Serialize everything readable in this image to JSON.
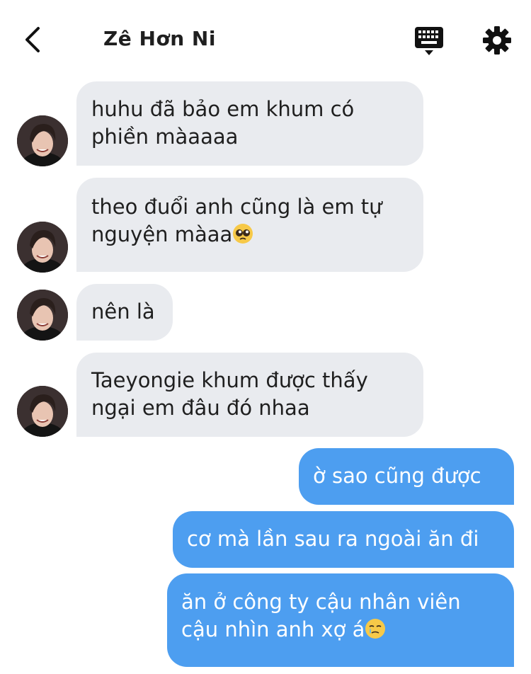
{
  "header": {
    "title": "Zê Hơn Ni",
    "icons": {
      "back": "chevron-left-icon",
      "keyboard": "keyboard-icon",
      "settings": "gear-icon"
    }
  },
  "messages": [
    {
      "from": "them",
      "lines": [
        "huhu đã bảo em khum có",
        "phiền màaaaa"
      ]
    },
    {
      "from": "them",
      "lines": [
        "theo đuổi anh cũng là em tự",
        "nguyện màaa"
      ],
      "emoji": "pleading-face"
    },
    {
      "from": "them",
      "lines": [
        "nên là"
      ]
    },
    {
      "from": "them",
      "lines": [
        "Taeyongie khum được thấy",
        "ngại em đâu đó nhaa"
      ]
    },
    {
      "from": "me",
      "lines": [
        "ờ sao cũng được"
      ]
    },
    {
      "from": "me",
      "lines": [
        "cơ mà lần sau ra ngoài ăn đi"
      ]
    },
    {
      "from": "me",
      "lines": [
        "ăn ở công ty cậu nhân viên",
        "cậu nhìn anh xợ á"
      ],
      "emoji": "face-holding-back-tears"
    }
  ],
  "colors": {
    "incoming": "#e9ebef",
    "outgoing": "#4d9ef0",
    "outgoing_text": "#ffffff"
  }
}
